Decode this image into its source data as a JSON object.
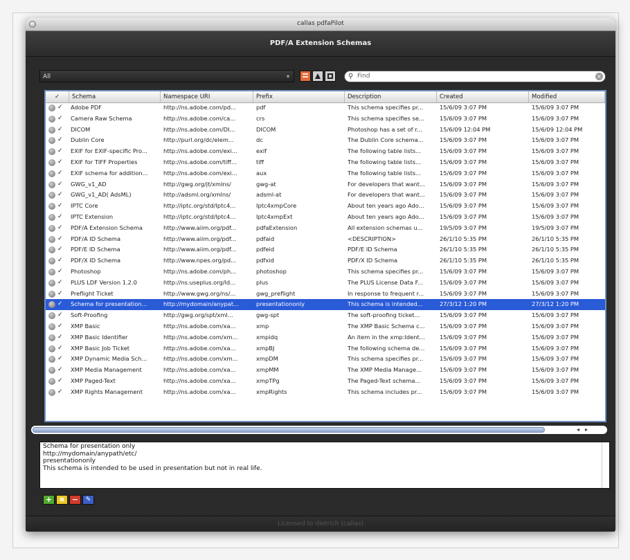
{
  "window": {
    "title": "callas pdfaPilot"
  },
  "header": {
    "title": "PDF/A Extension Schemas"
  },
  "toolbar": {
    "filter_value": "All",
    "search_placeholder": "Find",
    "view_icons": [
      "list-view-icon",
      "triangle-view-icon",
      "square-view-icon"
    ]
  },
  "table": {
    "columns": [
      "✓",
      "Schema",
      "Namespace URI",
      "Prefix",
      "Description",
      "Created",
      "Modified"
    ],
    "rows": [
      {
        "schema": "Adobe PDF",
        "uri": "http://ns.adobe.com/pd...",
        "prefix": "pdf",
        "description": "This schema specifies pr...",
        "created": "15/6/09 3:07 PM",
        "modified": "15/6/09 3:07 PM"
      },
      {
        "schema": "Camera Raw Schema",
        "uri": "http://ns.adobe.com/ca...",
        "prefix": "crs",
        "description": "This schema specifies se...",
        "created": "15/6/09 3:07 PM",
        "modified": "15/6/09 3:07 PM"
      },
      {
        "schema": "DICOM",
        "uri": "http://ns.adobe.com/DI...",
        "prefix": "DICOM",
        "description": "Photoshop has a set of r...",
        "created": "15/6/09 12:04 PM",
        "modified": "15/6/09 12:04 PM"
      },
      {
        "schema": "Dublin Core",
        "uri": "http://purl.org/dc/elem...",
        "prefix": "dc",
        "description": "The Dublin Core schema...",
        "created": "15/6/09 3:07 PM",
        "modified": "15/6/09 3:07 PM"
      },
      {
        "schema": "EXIF for EXIF-specific Pro...",
        "uri": "http://ns.adobe.com/exi...",
        "prefix": "exif",
        "description": "The following table lists...",
        "created": "15/6/09 3:07 PM",
        "modified": "15/6/09 3:07 PM"
      },
      {
        "schema": "EXIF for TIFF Properties",
        "uri": "http://ns.adobe.com/tiff...",
        "prefix": "tiff",
        "description": "The following table lists...",
        "created": "15/6/09 3:07 PM",
        "modified": "15/6/09 3:07 PM"
      },
      {
        "schema": "EXIF schema for addition...",
        "uri": "http://ns.adobe.com/exi...",
        "prefix": "aux",
        "description": "The following table lists...",
        "created": "15/6/09 3:07 PM",
        "modified": "15/6/09 3:07 PM"
      },
      {
        "schema": "GWG_v1_AD",
        "uri": "http://gwg.org/jt/xmlns/",
        "prefix": "gwg-at",
        "description": "For developers that want...",
        "created": "15/6/09 3:07 PM",
        "modified": "15/6/09 3:07 PM"
      },
      {
        "schema": "GWG_v1_AD( AdsML)",
        "uri": "http://adsml.org/xmlns/",
        "prefix": "adsml-at",
        "description": "For developers that want...",
        "created": "15/6/09 3:07 PM",
        "modified": "15/6/09 3:07 PM"
      },
      {
        "schema": "IPTC Core",
        "uri": "http://iptc.org/std/Iptc4...",
        "prefix": "Iptc4xmpCore",
        "description": "About ten years ago Ado...",
        "created": "15/6/09 3:07 PM",
        "modified": "15/6/09 3:07 PM"
      },
      {
        "schema": "IPTC Extension",
        "uri": "http://iptc.org/std/Iptc4...",
        "prefix": "Iptc4xmpExt",
        "description": "About ten years ago Ado...",
        "created": "15/6/09 3:07 PM",
        "modified": "15/6/09 3:07 PM"
      },
      {
        "schema": "PDF/A Extension Schema",
        "uri": "http://www.aiim.org/pdf...",
        "prefix": "pdfaExtension",
        "description": "All extension schemas u...",
        "created": "19/5/09 3:07 PM",
        "modified": "19/5/09 3:07 PM"
      },
      {
        "schema": "PDF/A ID Schema",
        "uri": "http://www.aiim.org/pdf...",
        "prefix": "pdfaid",
        "description": "<DESCRIPTION>",
        "created": "26/1/10 5:35 PM",
        "modified": "26/1/10 5:35 PM"
      },
      {
        "schema": "PDF/E ID Schema",
        "uri": "http://www.aiim.org/pdf...",
        "prefix": "pdfeid",
        "description": "PDF/E ID Schema",
        "created": "26/1/10 5:35 PM",
        "modified": "26/1/10 5:35 PM"
      },
      {
        "schema": "PDF/X ID Schema",
        "uri": "http://www.npes.org/pd...",
        "prefix": "pdfxid",
        "description": "PDF/X ID Schema",
        "created": "26/1/10 5:35 PM",
        "modified": "26/1/10 5:35 PM"
      },
      {
        "schema": "Photoshop",
        "uri": "http://ns.adobe.com/ph...",
        "prefix": "photoshop",
        "description": "This schema specifies pr...",
        "created": "15/6/09 3:07 PM",
        "modified": "15/6/09 3:07 PM"
      },
      {
        "schema": "PLUS LDF Version 1.2.0",
        "uri": "http://ns.useplus.org/ld...",
        "prefix": "plus",
        "description": "The PLUS License Data F...",
        "created": "15/6/09 3:07 PM",
        "modified": "15/6/09 3:07 PM"
      },
      {
        "schema": "Preflight Ticket",
        "uri": "http://www.gwg.org/ns/...",
        "prefix": "gwg_preflight",
        "description": "In response to frequent r...",
        "created": "15/6/09 3:07 PM",
        "modified": "15/6/09 3:07 PM"
      },
      {
        "schema": "Schema for presentation...",
        "uri": "http://mydomain/anypat...",
        "prefix": "presentationonly",
        "description": "This schema is intended...",
        "created": "27/3/12 1:20 PM",
        "modified": "27/3/12 1:20 PM",
        "selected": true
      },
      {
        "schema": "Soft-Proofing",
        "uri": "http://gwg.org/spt/xml...",
        "prefix": "gwg-spt",
        "description": "The soft-proofing ticket...",
        "created": "15/6/09 3:07 PM",
        "modified": "15/6/09 3:07 PM"
      },
      {
        "schema": "XMP Basic",
        "uri": "http://ns.adobe.com/xa...",
        "prefix": "xmp",
        "description": "The XMP Basic Schema c...",
        "created": "15/6/09 3:07 PM",
        "modified": "15/6/09 3:07 PM"
      },
      {
        "schema": "XMP Basic Identifier",
        "uri": "http://ns.adobe.com/xm...",
        "prefix": "xmpidq",
        "description": "An item in the xmp:Ident...",
        "created": "15/6/09 3:07 PM",
        "modified": "15/6/09 3:07 PM"
      },
      {
        "schema": "XMP Basic Job Ticket",
        "uri": "http://ns.adobe.com/xa...",
        "prefix": "xmpBJ",
        "description": "The following schema de...",
        "created": "15/6/09 3:07 PM",
        "modified": "15/6/09 3:07 PM"
      },
      {
        "schema": "XMP Dynamic Media Sch...",
        "uri": "http://ns.adobe.com/xm...",
        "prefix": "xmpDM",
        "description": "This schema specifies pr...",
        "created": "15/6/09 3:07 PM",
        "modified": "15/6/09 3:07 PM"
      },
      {
        "schema": "XMP Media Management",
        "uri": "http://ns.adobe.com/xa...",
        "prefix": "xmpMM",
        "description": "The XMP Media Manage...",
        "created": "15/6/09 3:07 PM",
        "modified": "15/6/09 3:07 PM"
      },
      {
        "schema": "XMP Paged-Text",
        "uri": "http://ns.adobe.com/xa...",
        "prefix": "xmpTPg",
        "description": "The Paged-Text schema...",
        "created": "15/6/09 3:07 PM",
        "modified": "15/6/09 3:07 PM"
      },
      {
        "schema": "XMP Rights Management",
        "uri": "http://ns.adobe.com/xa...",
        "prefix": "xmpRights",
        "description": "This schema includes pr...",
        "created": "15/6/09 3:07 PM",
        "modified": "15/6/09 3:07 PM"
      }
    ]
  },
  "details": {
    "lines": [
      "Schema for presentation only",
      "http://mydomain/anypath/etc/",
      "presentationonly",
      "This schema is intended to be used in presentation but not in real life."
    ]
  },
  "actions": {
    "add": "+",
    "duplicate": "⧉",
    "remove": "−",
    "edit": "✎"
  },
  "footer": {
    "text": "Licensed to dietrich (callas)"
  },
  "colors": {
    "selection": "#2a5bd7",
    "add": "#4faa2f",
    "remove": "#d23a2a",
    "duplicate": "#e9c821",
    "edit": "#3a5fc9"
  }
}
